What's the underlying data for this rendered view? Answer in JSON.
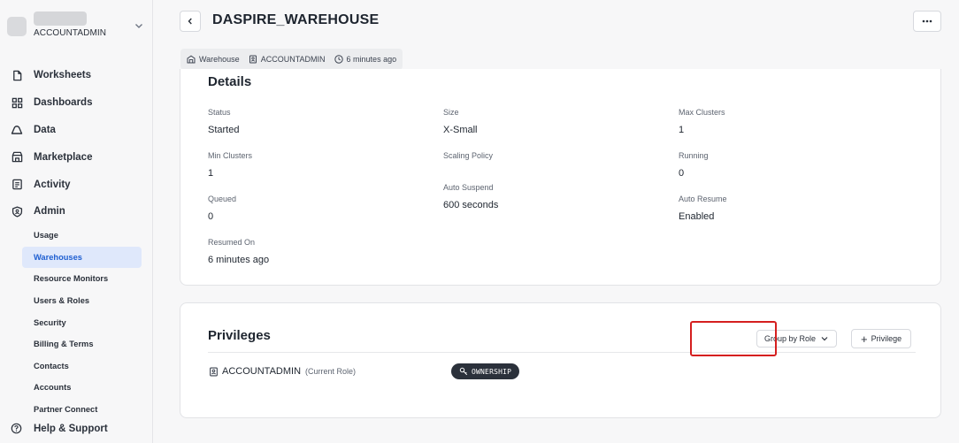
{
  "account": {
    "role": "ACCOUNTADMIN"
  },
  "nav": {
    "items": [
      {
        "label": "Worksheets",
        "icon": "file-icon"
      },
      {
        "label": "Dashboards",
        "icon": "grid-icon"
      },
      {
        "label": "Data",
        "icon": "cloud-icon"
      },
      {
        "label": "Marketplace",
        "icon": "store-icon"
      },
      {
        "label": "Activity",
        "icon": "activity-icon"
      },
      {
        "label": "Admin",
        "icon": "shield-icon"
      }
    ],
    "admin_sub": [
      "Usage",
      "Warehouses",
      "Resource Monitors",
      "Users & Roles",
      "Security",
      "Billing & Terms",
      "Contacts",
      "Accounts",
      "Partner Connect"
    ],
    "active_sub": "Warehouses",
    "help": "Help & Support"
  },
  "header": {
    "title": "DASPIRE_WAREHOUSE",
    "meta": {
      "type": "Warehouse",
      "owner": "ACCOUNTADMIN",
      "time": "6 minutes ago"
    }
  },
  "details": {
    "title": "Details",
    "fields": {
      "status": {
        "label": "Status",
        "value": "Started"
      },
      "size": {
        "label": "Size",
        "value": "X-Small"
      },
      "max_clusters": {
        "label": "Max Clusters",
        "value": "1"
      },
      "min_clusters": {
        "label": "Min Clusters",
        "value": "1"
      },
      "scaling_policy": {
        "label": "Scaling Policy",
        "value": ""
      },
      "running": {
        "label": "Running",
        "value": "0"
      },
      "queued": {
        "label": "Queued",
        "value": "0"
      },
      "auto_suspend": {
        "label": "Auto Suspend",
        "value": "600 seconds"
      },
      "auto_resume": {
        "label": "Auto Resume",
        "value": "Enabled"
      },
      "resumed_on": {
        "label": "Resumed On",
        "value": "6 minutes ago"
      }
    }
  },
  "privileges": {
    "title": "Privileges",
    "group_by": "Group by Role",
    "add_label": "Privilege",
    "rows": [
      {
        "role": "ACCOUNTADMIN",
        "note": "(Current Role)",
        "privilege": "OWNERSHIP"
      }
    ]
  },
  "colors": {
    "active_bg": "#dfe8fb",
    "active_text": "#1f5fd1",
    "highlight": "#d51f1f",
    "badge_bg": "#2b313b"
  }
}
